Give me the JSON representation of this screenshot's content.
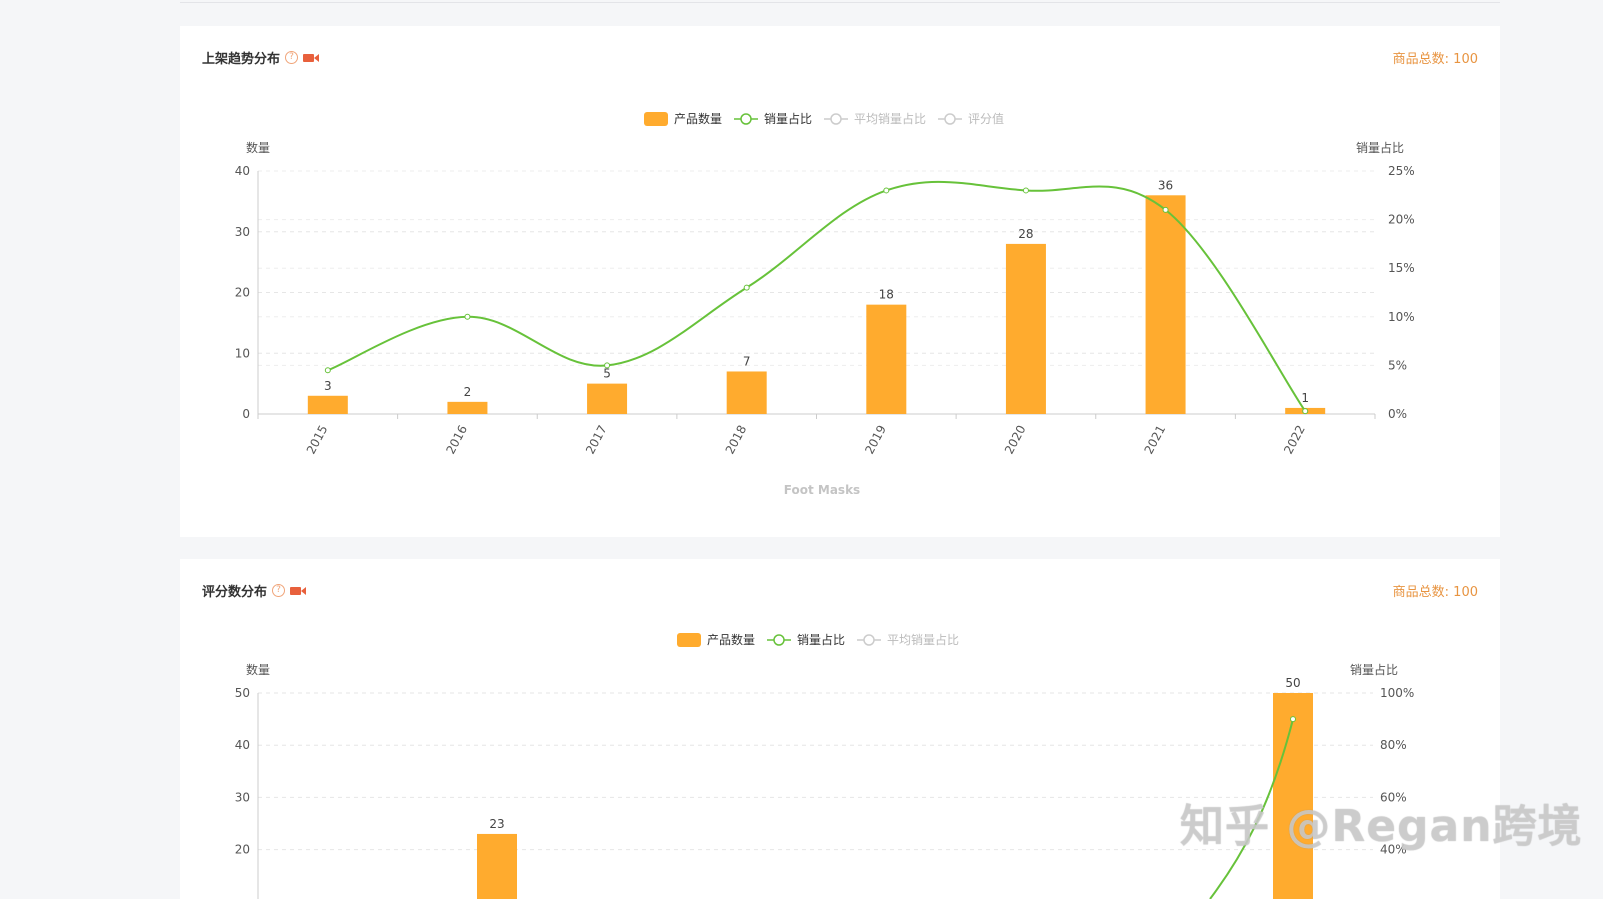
{
  "watermark": "知乎 @Regan跨境",
  "colors": {
    "bar": "#ffab2e",
    "line": "#67c23a",
    "legend_inactive": "#cccccc",
    "accent": "#e89441"
  },
  "cards": [
    {
      "title": "上架趋势分布",
      "help_icon": "question-circle-icon",
      "video_icon": "video-camera-icon",
      "total_label": "商品总数: 100"
    },
    {
      "title": "评分数分布",
      "help_icon": "question-circle-icon",
      "video_icon": "video-camera-icon",
      "total_label": "商品总数: 100"
    }
  ],
  "chart_data": [
    {
      "type": "bar",
      "xlabel": "Foot Masks",
      "ylabel": "数量",
      "y2label": "销量占比",
      "ylim": [
        0,
        40
      ],
      "y2lim": [
        0,
        25
      ],
      "y_ticks": [
        "0",
        "10",
        "20",
        "30",
        "40"
      ],
      "y2_ticks": [
        "0%",
        "5%",
        "10%",
        "15%",
        "20%",
        "25%"
      ],
      "categories": [
        "2015",
        "2016",
        "2017",
        "2018",
        "2019",
        "2020",
        "2021",
        "2022"
      ],
      "legend": [
        {
          "name": "产品数量",
          "kind": "bar",
          "active": true
        },
        {
          "name": "销量占比",
          "kind": "line",
          "active": true
        },
        {
          "name": "平均销量占比",
          "kind": "line",
          "active": false
        },
        {
          "name": "评分值",
          "kind": "line",
          "active": false
        }
      ],
      "series": [
        {
          "name": "产品数量",
          "type": "bar",
          "axis": "left",
          "values": [
            3,
            2,
            5,
            7,
            18,
            28,
            36,
            1
          ]
        },
        {
          "name": "销量占比",
          "type": "line",
          "axis": "right",
          "values": [
            4.5,
            10,
            5,
            13,
            23,
            23,
            21,
            0.3
          ]
        }
      ],
      "grid": true,
      "legend_position": "top-center"
    },
    {
      "type": "bar",
      "ylabel": "数量",
      "y2label": "销量占比",
      "ylim": [
        0,
        50
      ],
      "y2lim": [
        0,
        100
      ],
      "y_ticks": [
        "20",
        "30",
        "40",
        "50"
      ],
      "y2_ticks": [
        "40%",
        "60%",
        "80%",
        "100%"
      ],
      "legend": [
        {
          "name": "产品数量",
          "kind": "bar",
          "active": true
        },
        {
          "name": "销量占比",
          "kind": "line",
          "active": true
        },
        {
          "name": "平均销量占比",
          "kind": "line",
          "active": false
        }
      ],
      "series": [
        {
          "name": "产品数量",
          "type": "bar",
          "axis": "left",
          "visible_values": [
            23,
            50
          ]
        },
        {
          "name": "销量占比",
          "type": "line",
          "axis": "right",
          "visible_peak": 90
        }
      ],
      "grid": true,
      "legend_position": "top-center"
    }
  ]
}
